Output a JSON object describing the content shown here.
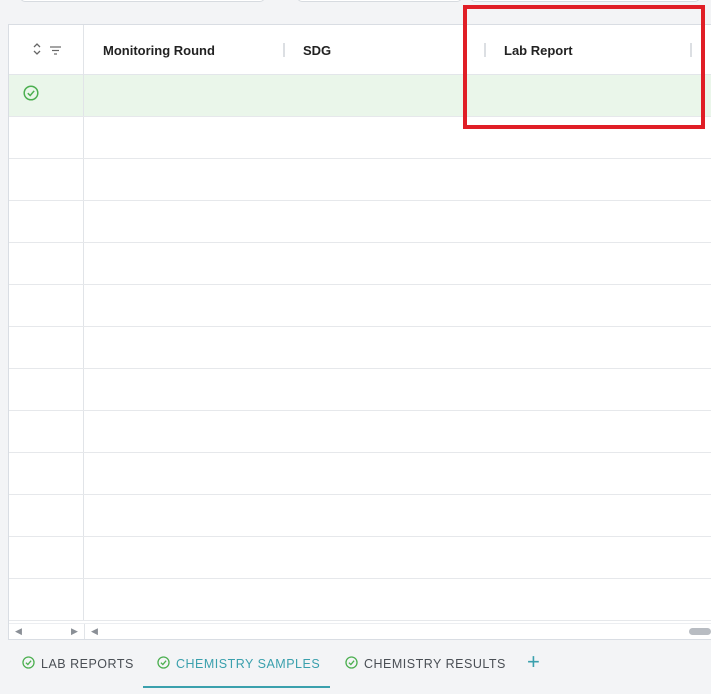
{
  "grid": {
    "row_header_icons": {
      "sort": "sort-updown-icon",
      "filter": "filter-icon"
    },
    "columns": [
      {
        "label": "Monitoring Round"
      },
      {
        "label": "SDG"
      },
      {
        "label": "Lab Report"
      }
    ],
    "row_count_visible": 13,
    "selected_row_index": 0,
    "selected_row_status": "check-circle-icon"
  },
  "tabs": [
    {
      "label": "LAB REPORTS",
      "icon": "check-circle-icon",
      "active": false
    },
    {
      "label": "CHEMISTRY SAMPLES",
      "icon": "check-circle-icon",
      "active": true
    },
    {
      "label": "CHEMISTRY RESULTS",
      "icon": "check-circle-icon",
      "active": false
    }
  ],
  "add_tab": {
    "label": "+"
  },
  "colors": {
    "accent": "#3aa0ad",
    "selected_row": "#eaf6ea",
    "check_green": "#4caf50",
    "highlight": "#e01e26"
  }
}
